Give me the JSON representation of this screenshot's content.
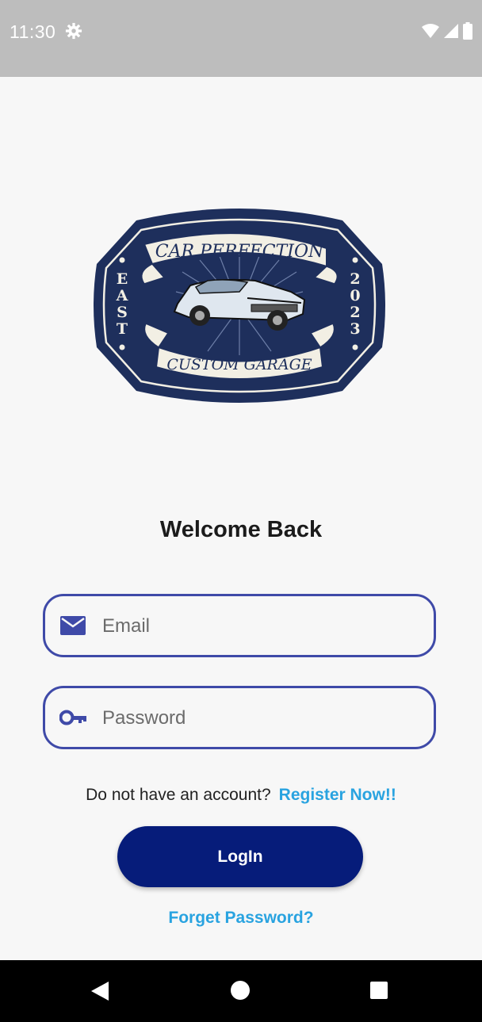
{
  "status_bar": {
    "time": "11:30",
    "icons": [
      "gear-icon",
      "wifi-icon",
      "signal-icon",
      "battery-icon"
    ]
  },
  "logo": {
    "top_text": "CAR PERFECTION",
    "bottom_text": "CUSTOM GARAGE",
    "left_text": "EAST",
    "right_text": "2023"
  },
  "welcome_title": "Welcome Back",
  "email": {
    "placeholder": "Email",
    "value": "",
    "icon": "mail-icon"
  },
  "password": {
    "placeholder": "Password",
    "value": "",
    "icon": "key-icon"
  },
  "register": {
    "prompt": "Do not have an account?",
    "link": "Register Now!!"
  },
  "login_button": "LogIn",
  "forget_password": "Forget Password?",
  "colors": {
    "accent": "#3f4aa8",
    "button": "#061c7a",
    "link": "#29a3e0",
    "logo_navy": "#1e2f5c",
    "logo_cream": "#f2efe4"
  },
  "nav_bar": [
    "back-icon",
    "home-icon",
    "recent-apps-icon"
  ]
}
